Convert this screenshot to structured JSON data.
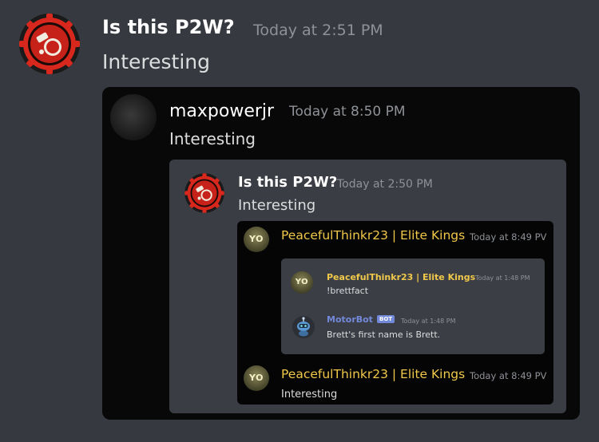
{
  "outer": {
    "username": "Is this P2W?",
    "timestamp": "Today at 2:51 PM",
    "text": "Interesting",
    "avatar_icon": "red-gear-emblem-icon"
  },
  "quote1": {
    "username": "maxpowerjr",
    "timestamp": "Today at 8:50 PM",
    "text": "Interesting",
    "avatar_icon": "dark-avatar"
  },
  "quote2": {
    "username": "Is this P2W?",
    "timestamp": "Today at 2:50 PM",
    "text": "Interesting",
    "avatar_icon": "red-gear-emblem-icon"
  },
  "quote3": {
    "msg1": {
      "avatar_text": "YO",
      "username": "PeacefulThinkr23 | Elite Kings",
      "timestamp": "Today at 8:49 PV"
    },
    "inner": {
      "msg1": {
        "avatar_text": "YO",
        "username": "PeacefulThinkr23 | Elite Kings",
        "timestamp": "Today at 1:48 PM",
        "text": "!brettfact"
      },
      "msg2": {
        "username": "MotorBot",
        "badge": "BOT",
        "timestamp": "Today at 1:48 PM",
        "text": "Brett's first name is Brett.",
        "avatar_icon": "robot-icon"
      }
    },
    "msg2": {
      "avatar_text": "YO",
      "username": "PeacefulThinkr23 | Elite Kings",
      "timestamp": "Today at 8:49 PV",
      "text": "Interesting"
    }
  },
  "colors": {
    "background": "#36393f",
    "gold_username": "#f0c84a",
    "bot_blue": "#7289da",
    "emblem_red": "#d8281e"
  }
}
